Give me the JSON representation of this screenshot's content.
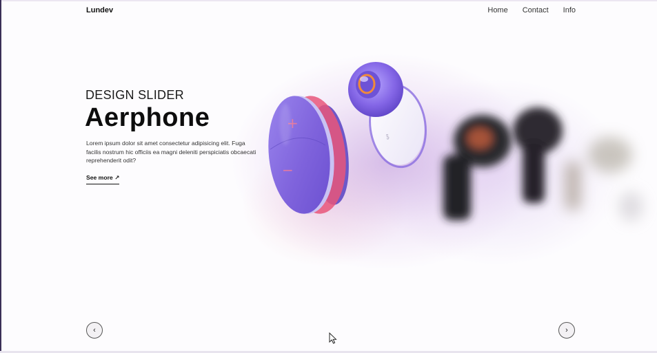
{
  "header": {
    "logo": "Lundev",
    "nav": [
      "Home",
      "Contact",
      "Info"
    ]
  },
  "hero": {
    "subtitle": "DESIGN SLIDER",
    "title": "Aerphone",
    "description": "Lorem ipsum dolor sit amet consectetur adipisicing elit. Fuga facilis nostrum hic officiis ea magni deleniti perspiciatis obcaecati reprehenderit odit?",
    "see_more": "See more ↗"
  },
  "slider": {
    "prev_label": "‹",
    "next_label": "›"
  },
  "product_visual": {
    "front_plus": "+",
    "front_minus": "−"
  },
  "colors": {
    "accent_purple": "#8a6de0",
    "glow": "#c9a6e6",
    "text": "#111111"
  }
}
